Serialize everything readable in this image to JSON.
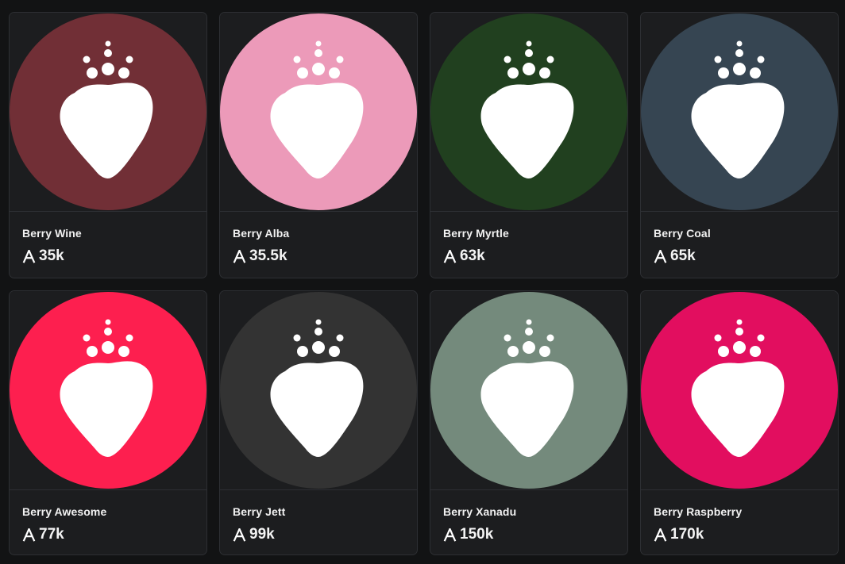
{
  "currency_icon": "algorand-icon",
  "logo_icon": "crowned-strawberry-icon",
  "cards": [
    {
      "name": "Berry Wine",
      "price": "35k",
      "color": "#712f36"
    },
    {
      "name": "Berry Alba",
      "price": "35.5k",
      "color": "#ec9ab9"
    },
    {
      "name": "Berry Myrtle",
      "price": "63k",
      "color": "#21401f"
    },
    {
      "name": "Berry Coal",
      "price": "65k",
      "color": "#364552"
    },
    {
      "name": "Berry Awesome",
      "price": "77k",
      "color": "#fd1f4f"
    },
    {
      "name": "Berry Jett",
      "price": "99k",
      "color": "#333333"
    },
    {
      "name": "Berry Xanadu",
      "price": "150k",
      "color": "#748a7c"
    },
    {
      "name": "Berry Raspberry",
      "price": "170k",
      "color": "#e20e5f"
    }
  ]
}
